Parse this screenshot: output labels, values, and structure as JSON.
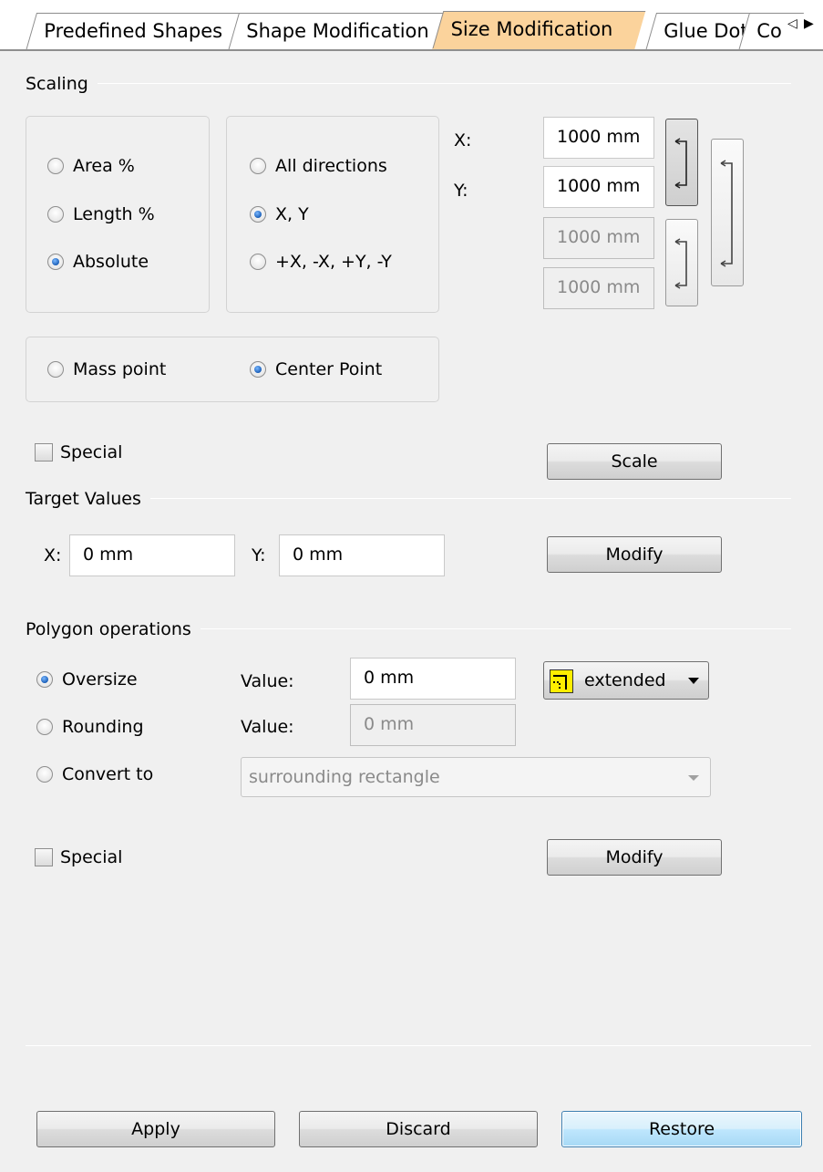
{
  "tabs": [
    {
      "label": "Predefined Shapes",
      "active": false
    },
    {
      "label": "Shape Modification",
      "active": false
    },
    {
      "label": "Size Modification",
      "active": true
    },
    {
      "label": "Glue Dots",
      "active": false
    },
    {
      "label": "Co",
      "active": false
    }
  ],
  "scaling": {
    "title": "Scaling",
    "mode_options": [
      {
        "label": "Area %",
        "checked": false
      },
      {
        "label": "Length %",
        "checked": false
      },
      {
        "label": "Absolute",
        "checked": true
      }
    ],
    "direction_options": [
      {
        "label": "All directions",
        "checked": false
      },
      {
        "label": "X, Y",
        "checked": true
      },
      {
        "label": "+X, -X, +Y, -Y",
        "checked": false
      }
    ],
    "point_options": [
      {
        "label": "Mass point",
        "checked": false
      },
      {
        "label": "Center Point",
        "checked": true
      }
    ],
    "x_label": "X:",
    "y_label": "Y:",
    "x_value": "1000 mm",
    "y_value": "1000 mm",
    "disabled_value_1": "1000 mm",
    "disabled_value_2": "1000 mm",
    "special_label": "Special",
    "special_checked": false,
    "scale_button": "Scale"
  },
  "target_values": {
    "title": "Target Values",
    "x_label": "X:",
    "x_value": "0 mm",
    "y_label": "Y:",
    "y_value": "0 mm",
    "modify_button": "Modify"
  },
  "polygon": {
    "title": "Polygon operations",
    "oversize_label": "Oversize",
    "oversize_checked": true,
    "rounding_label": "Rounding",
    "convert_label": "Convert to",
    "value_label_1": "Value:",
    "value_1": "0 mm",
    "value_label_2": "Value:",
    "value_2": "0 mm",
    "mode_dropdown": "extended",
    "convert_dropdown": "surrounding rectangle",
    "special_label": "Special",
    "modify_button": "Modify"
  },
  "footer": {
    "apply": "Apply",
    "discard": "Discard",
    "restore": "Restore"
  },
  "icons": {
    "dropdown_icon_color": "#ffee00",
    "active_tab_color": "#fbd39c",
    "radio_dot_color": "#1b5fb8"
  }
}
